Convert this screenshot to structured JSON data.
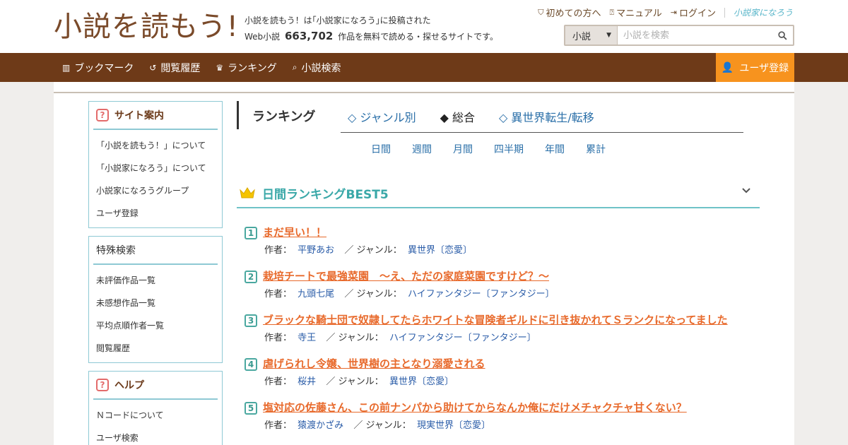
{
  "header": {
    "logo": "小説を読もう!",
    "tagline_line1": "小説を読もう！は｢小説家になろう｣に投稿された",
    "tagline_prefix": "Web小説",
    "work_count": "663,702",
    "tagline_suffix": "作品を無料で読める・探せるサイトです。",
    "top_links": {
      "first_time": "初めての方へ",
      "manual": "マニュアル",
      "login": "ログイン",
      "brand": "小説家になろう"
    },
    "search": {
      "select_value": "小説",
      "placeholder": "小説を検索"
    }
  },
  "nav": {
    "items": [
      "ブックマーク",
      "閲覧履歴",
      "ランキング",
      "小説検索"
    ],
    "register": "ユーザ登録"
  },
  "sidebar": {
    "site_guide": {
      "title": "サイト案内",
      "items": [
        "「小説を読もう！」について",
        "「小説家になろう」について",
        "小説家になろうグループ",
        "ユーザ登録"
      ]
    },
    "special_search": {
      "title": "特殊検索",
      "items": [
        "未評価作品一覧",
        "未感想作品一覧",
        "平均点順作者一覧",
        "閲覧履歴"
      ]
    },
    "help": {
      "title": "ヘルプ",
      "items": [
        "Ｎコードについて",
        "ユーザ検索"
      ]
    }
  },
  "ranking": {
    "title": "ランキング",
    "tabs": [
      "◇ ジャンル別",
      "◆ 総合",
      "◇ 異世界転生/転移"
    ],
    "periods": [
      "日間",
      "週間",
      "月間",
      "四半期",
      "年間",
      "累計"
    ],
    "best_title": "日間ランキングBEST5",
    "author_label": "作者：",
    "genre_label": "／ ジャンル：",
    "items": [
      {
        "num": "1",
        "title": "まだ早い！！",
        "author": "平野あお",
        "genre": "異世界〔恋愛〕"
      },
      {
        "num": "2",
        "title": "栽培チートで最強菜園　～え、ただの家庭菜園ですけど？～",
        "author": "九頭七尾",
        "genre": "ハイファンタジー〔ファンタジー〕"
      },
      {
        "num": "3",
        "title": "ブラックな騎士団で奴隷してたらホワイトな冒険者ギルドに引き抜かれてＳランクになってました",
        "author": "寺王",
        "genre": "ハイファンタジー〔ファンタジー〕"
      },
      {
        "num": "4",
        "title": "虐げられし令嬢、世界樹の主となり溺愛される",
        "author": "桜井",
        "genre": "異世界〔恋愛〕"
      },
      {
        "num": "5",
        "title": "塩対応の佐藤さん、この前ナンパから助けてからなんか俺にだけメチャクチャ甘くない？",
        "author": "猿渡かざみ",
        "genre": "現実世界〔恋愛〕"
      }
    ]
  }
}
